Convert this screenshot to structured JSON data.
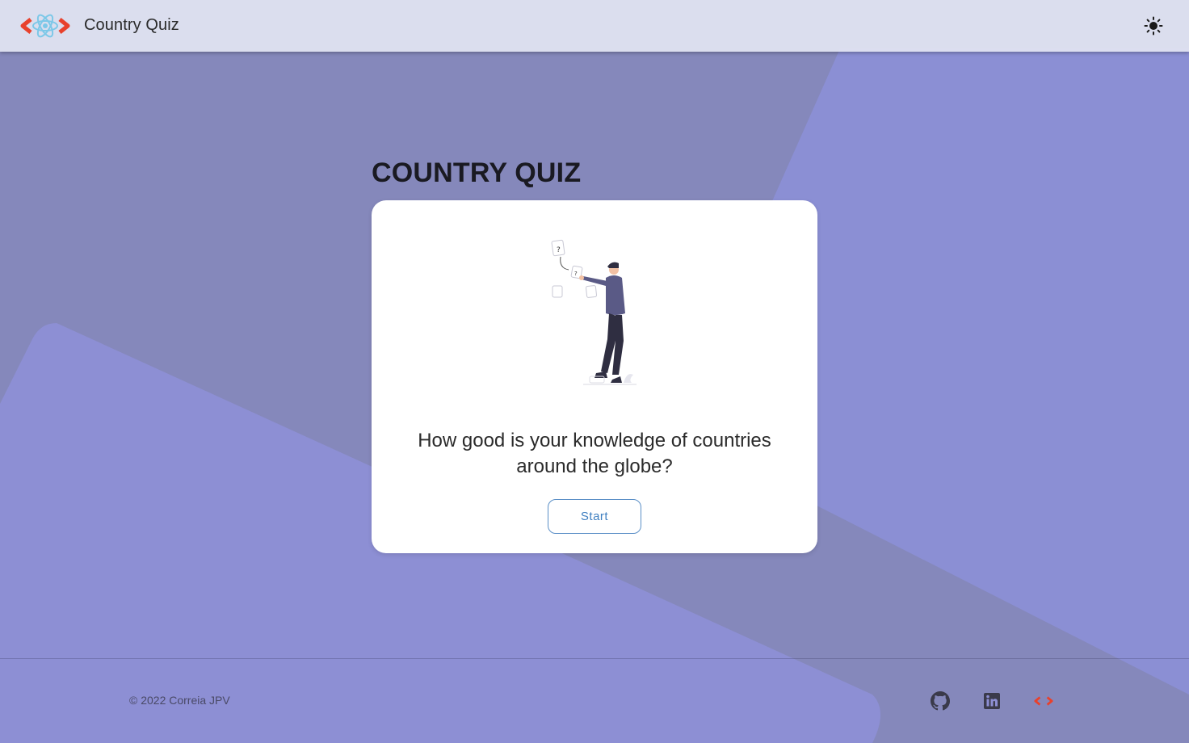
{
  "header": {
    "logo_icon": "react-brackets-logo-icon",
    "title": "Country Quiz",
    "theme_toggle_icon": "sun-icon"
  },
  "main": {
    "title": "COUNTRY QUIZ",
    "illustration_icon": "person-with-questions-illustration",
    "question": "How good is your knowledge of countries around the globe?",
    "start_label": "Start"
  },
  "footer": {
    "copyright": "© 2022 Correia JPV",
    "links": [
      {
        "icon": "github-icon"
      },
      {
        "icon": "linkedin-icon"
      },
      {
        "icon": "code-brackets-icon"
      }
    ]
  },
  "colors": {
    "background": "#8588bb",
    "background_shape": "#8d8fd4",
    "header": "#e2e4f2",
    "accent_red": "#e8412c",
    "accent_blue": "#3f7fc0",
    "card": "#ffffff"
  }
}
